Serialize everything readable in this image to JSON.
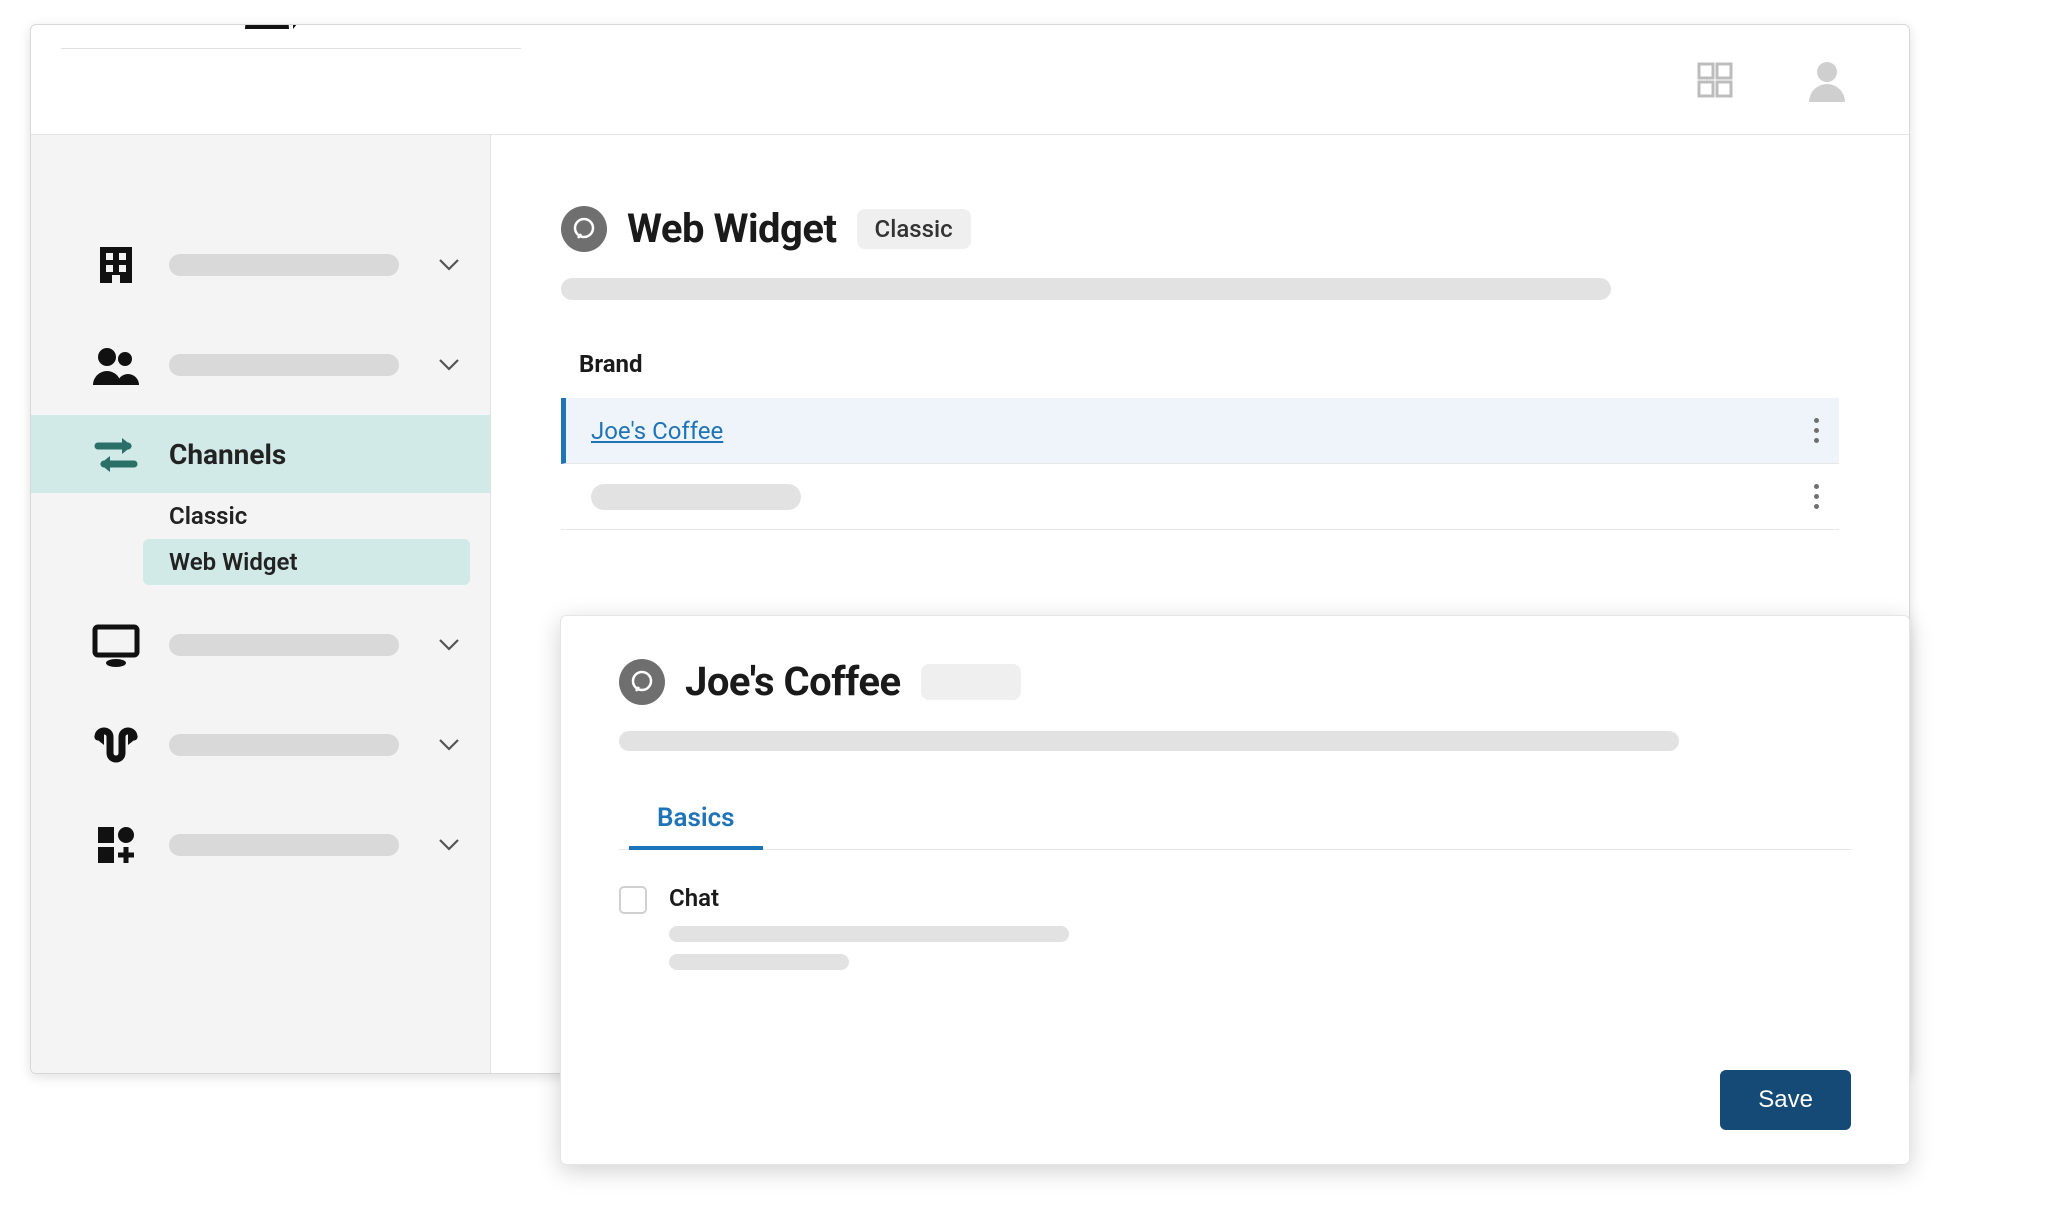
{
  "sidebar": {
    "channels_label": "Channels",
    "sub_items": {
      "classic": "Classic",
      "web_widget": "Web Widget"
    }
  },
  "topbar": {},
  "page": {
    "title": "Web Widget",
    "tag": "Classic",
    "section_brand_label": "Brand",
    "brands": {
      "selected": "Joe's Coffee"
    }
  },
  "detail": {
    "title": "Joe's Coffee",
    "tabs": {
      "basics": "Basics"
    },
    "option_chat_label": "Chat",
    "save_button": "Save"
  }
}
